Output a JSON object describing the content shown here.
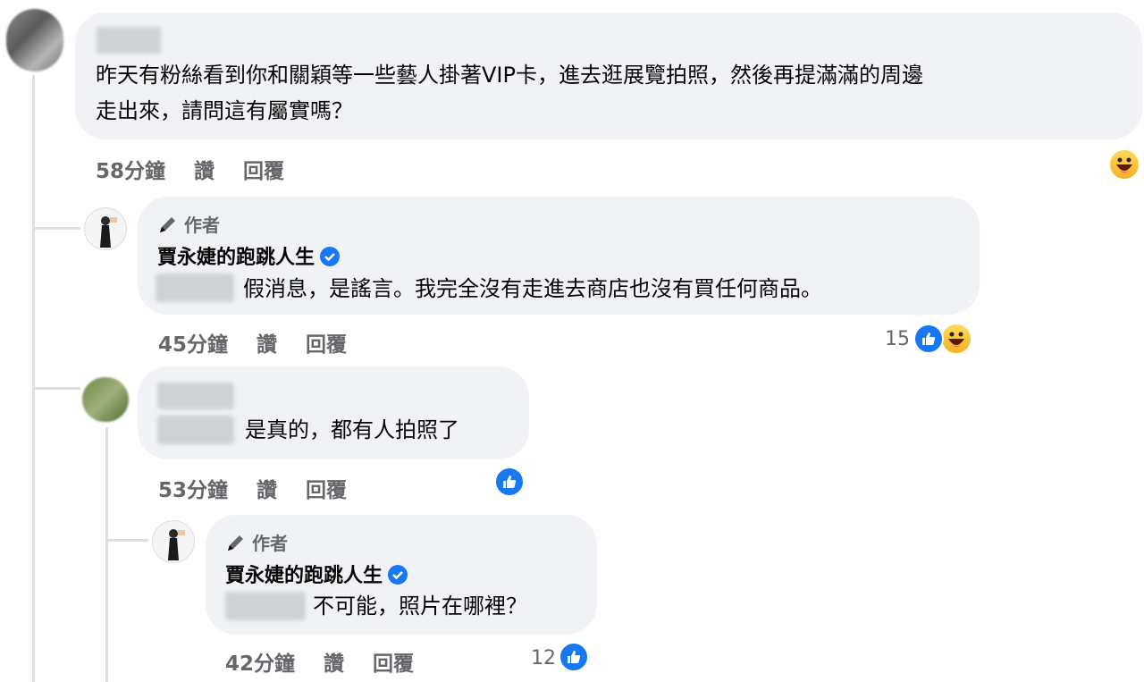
{
  "comments": {
    "top": {
      "text_line1": "昨天有粉絲看到你和關穎等一些藝人掛著VIP卡，進去逛展覽拍照，然後再提滿滿的周邊",
      "text_line2": "走出來，請問這有屬實嗎？",
      "time": "58分鐘",
      "like": "讚",
      "reply": "回覆"
    },
    "reply1": {
      "author_tag": "作者",
      "name": "賈永婕的跑跳人生",
      "text": "假消息，是謠言。我完全沒有走進去商店也沒有買任何商品。",
      "time": "45分鐘",
      "like": "讚",
      "reply": "回覆",
      "reaction_count": "15"
    },
    "reply2": {
      "text": "是真的，都有人拍照了",
      "time": "53分鐘",
      "like": "讚",
      "reply": "回覆"
    },
    "reply3": {
      "author_tag": "作者",
      "name": "賈永婕的跑跳人生",
      "text": "不可能，照片在哪裡？",
      "time": "42分鐘",
      "like": "讚",
      "reply": "回覆",
      "reaction_count": "12"
    }
  },
  "icons": {
    "like": "thumbs-up-icon",
    "haha": "laughing-face-icon",
    "author": "pencil-icon",
    "verified": "verified-badge-icon"
  },
  "colors": {
    "bubble": "#f0f2f5",
    "meta": "#65676b",
    "like": "#1877f2",
    "haha": "#f7b125"
  }
}
